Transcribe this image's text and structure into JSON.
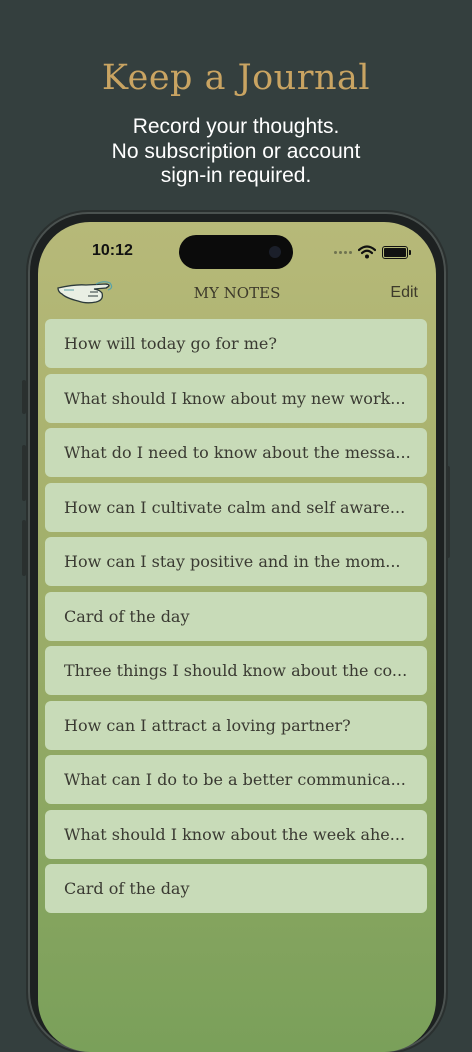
{
  "promo": {
    "title": "Keep a Journal",
    "subtitle": "Record your thoughts.\nNo subscription or account\nsign-in required."
  },
  "status_bar": {
    "time": "10:12",
    "icons": [
      "signal-dots-icon",
      "wifi-icon",
      "battery-icon"
    ]
  },
  "nav": {
    "title": "MY NOTES",
    "edit_label": "Edit",
    "menu_icon": "pointing-hand-icon"
  },
  "notes": [
    {
      "title": "How will today go for me?"
    },
    {
      "title": "What should I know about my new work..."
    },
    {
      "title": "What do I need to know about the messa..."
    },
    {
      "title": "How can I cultivate calm and self aware..."
    },
    {
      "title": "How can I stay positive and in the mom..."
    },
    {
      "title": "Card of the day"
    },
    {
      "title": "Three things I should know about the co..."
    },
    {
      "title": "How can I attract a loving partner?"
    },
    {
      "title": "What can I do to be a better communica..."
    },
    {
      "title": "What should I know about the week ahe..."
    },
    {
      "title": "Card of the day"
    }
  ],
  "colors": {
    "background": "#343f3e",
    "promo_title": "#c9a462",
    "note_card": "#c8dbb8",
    "screen_top": "#b7b979",
    "screen_bottom": "#7aa05a"
  }
}
